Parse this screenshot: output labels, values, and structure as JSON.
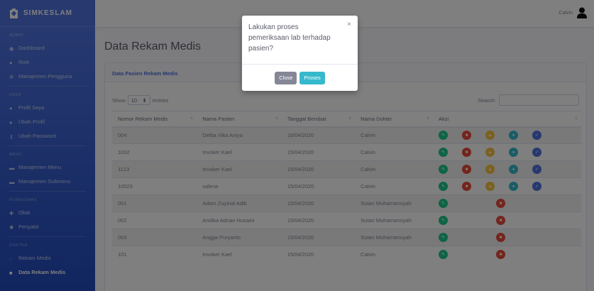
{
  "brand": {
    "name": "SIMKESLAM"
  },
  "sidebar": {
    "sections": [
      {
        "heading": "ADMIN",
        "items": [
          "Dashboard",
          "Role",
          "Manajemen Pengguna"
        ]
      },
      {
        "heading": "USER",
        "items": [
          "Profil Saya",
          "Ubah Profil",
          "Ubah Password"
        ]
      },
      {
        "heading": "MENU",
        "items": [
          "Manajemen Menu",
          "Manajemen Submenu"
        ]
      },
      {
        "heading": "PUSKESMAS",
        "items": [
          "Obat",
          "Penyakit"
        ]
      },
      {
        "heading": "DOKTER",
        "items": [
          "Rekam Medis",
          "Data Rekam Medis"
        ]
      }
    ]
  },
  "topbar": {
    "user_name": "Calvin"
  },
  "page": {
    "title": "Data Rekam Medis"
  },
  "card": {
    "header": "Data Pasien Rekam Medis",
    "show_label": "Show",
    "entries_value": "10",
    "entries_label": "entries",
    "search_label": "Search:"
  },
  "table": {
    "columns": [
      "Nomor Rekam Medis",
      "Nama Pasien",
      "Tanggal Berobat",
      "Nama Dokter",
      "Aksi"
    ],
    "rows": [
      {
        "no": "004",
        "pasien": "Delba Vika Aniya",
        "tanggal": "16/04/2020",
        "dokter": "Calvin",
        "full": true
      },
      {
        "no": "1002",
        "pasien": "Invoker Kael",
        "tanggal": "15/04/2020",
        "dokter": "Calvin",
        "full": true
      },
      {
        "no": "1123",
        "pasien": "Invoker Kael",
        "tanggal": "15/04/2020",
        "dokter": "Calvin",
        "full": true
      },
      {
        "no": "10023",
        "pasien": "salena",
        "tanggal": "15/04/2020",
        "dokter": "Calvin",
        "full": true
      },
      {
        "no": "001",
        "pasien": "Adam Zuyinal Adib",
        "tanggal": "15/04/2020",
        "dokter": "Sutan Muharramsyah",
        "full": false
      },
      {
        "no": "002",
        "pasien": "Andika Adnan Husaini",
        "tanggal": "15/04/2020",
        "dokter": "Sutan Muharramsyah",
        "full": false
      },
      {
        "no": "003",
        "pasien": "Angga Puryanto",
        "tanggal": "15/04/2020",
        "dokter": "Sutan Muharramsyah",
        "full": false
      },
      {
        "no": "101",
        "pasien": "Invoker Kael",
        "tanggal": "15/04/2020",
        "dokter": "Calvin",
        "full": false
      }
    ]
  },
  "modal": {
    "title": "Lakukan proses pemeriksaan lab terhadap pasien?",
    "close_symbol": "×",
    "close_label": "Close",
    "confirm_label": "Proses"
  },
  "colors": {
    "sidebar": "#4e73df",
    "edit": "#1cc88a",
    "delete": "#e74a3b",
    "lab": "#f6c23e",
    "doctor": "#36b9cc",
    "done": "#4e73df"
  },
  "icons": {
    "brand": "hospital-icon",
    "row_actions": [
      "edit-icon",
      "delete-icon",
      "lab-icon",
      "doctor-icon",
      "check-icon"
    ]
  }
}
